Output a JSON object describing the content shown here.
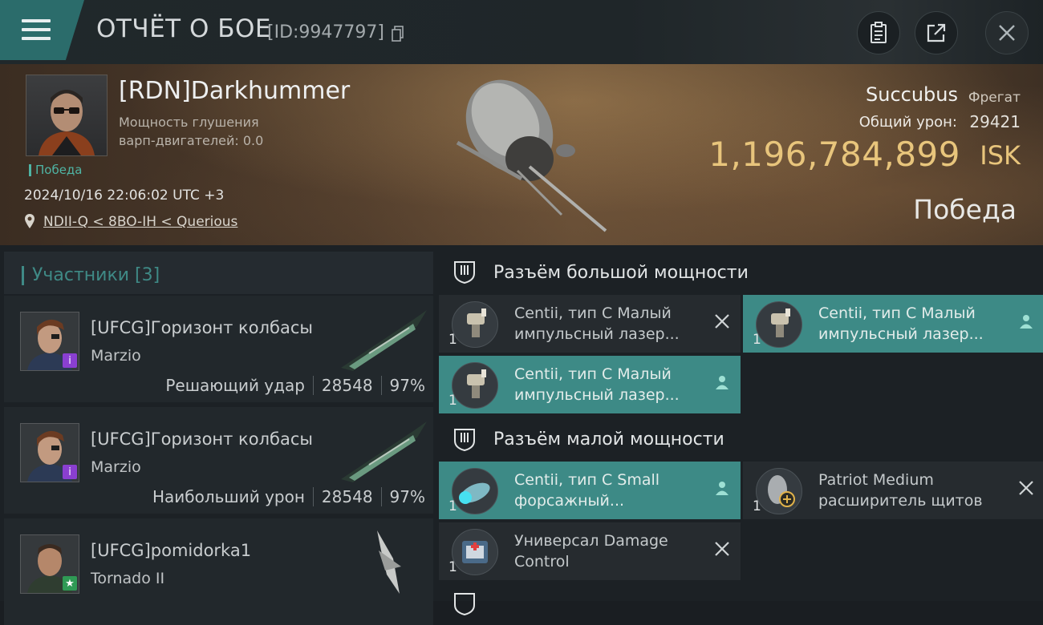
{
  "header": {
    "title": "ОТЧЁТ О БОЕ",
    "battle_id": "[ID:9947797]",
    "icons": [
      "menu-icon",
      "copy-icon",
      "report-icon",
      "share-icon",
      "close-icon"
    ]
  },
  "pilot": {
    "name": "[RDN]Darkhummer",
    "warp_label_line1": "Мощность глушения",
    "warp_label_line2": "варп-двигателей: 0.0",
    "status": "Победа",
    "datetime": "2024/10/16 22:06:02 UTC +3",
    "location": "NDII-Q < 8BO-IH < Querious"
  },
  "victim_ship": {
    "name": "Succubus",
    "class": "Фрегат",
    "total_damage_label": "Общий урон:",
    "total_damage": "29421",
    "isk_value": "1,196,784,899",
    "isk_label": "ISK",
    "result": "Победа"
  },
  "participants": {
    "title": "Участники [3]",
    "rows": [
      {
        "name": "[UFCG]Горизонт колбасы",
        "ship": "Marzio",
        "role": "Решающий удар",
        "damage": "28548",
        "percent": "97%",
        "badge": "i",
        "badge_color": "#8a3fd0"
      },
      {
        "name": "[UFCG]Горизонт колбасы",
        "ship": "Marzio",
        "role": "Наибольший урон",
        "damage": "28548",
        "percent": "97%",
        "badge": "i",
        "badge_color": "#8a3fd0"
      },
      {
        "name": "[UFCG]pomidorka1",
        "ship": "Tornado II",
        "role": "",
        "damage": "",
        "percent": "",
        "badge": "★",
        "badge_color": "#2f9a55"
      }
    ]
  },
  "modules": {
    "high_slot_title": "Разъём большой мощности",
    "low_slot_title": "Разъём малой мощности",
    "high": [
      {
        "qty": "1",
        "line1": "Centii, тип C Малый",
        "line2": "импульсный лазер...",
        "state": "destroyed"
      },
      {
        "qty": "1",
        "line1": "Centii, тип C Малый",
        "line2": "импульсный лазер...",
        "state": "dropped"
      },
      {
        "qty": "1",
        "line1": "Centii, тип C Малый",
        "line2": "импульсный лазер...",
        "state": "dropped"
      }
    ],
    "low": [
      {
        "qty": "1",
        "line1": "Centii, тип C Small",
        "line2": "форсажный...",
        "state": "dropped"
      },
      {
        "qty": "1",
        "line1": "Patriot Medium",
        "line2": "расширитель щитов",
        "state": "destroyed"
      },
      {
        "qty": "1",
        "line1": "Универсал Damage",
        "line2": "Control",
        "state": "destroyed"
      }
    ]
  },
  "colors": {
    "accent": "#3d8a86",
    "isk": "#e8c57c",
    "victory": "#4fb4a4"
  }
}
